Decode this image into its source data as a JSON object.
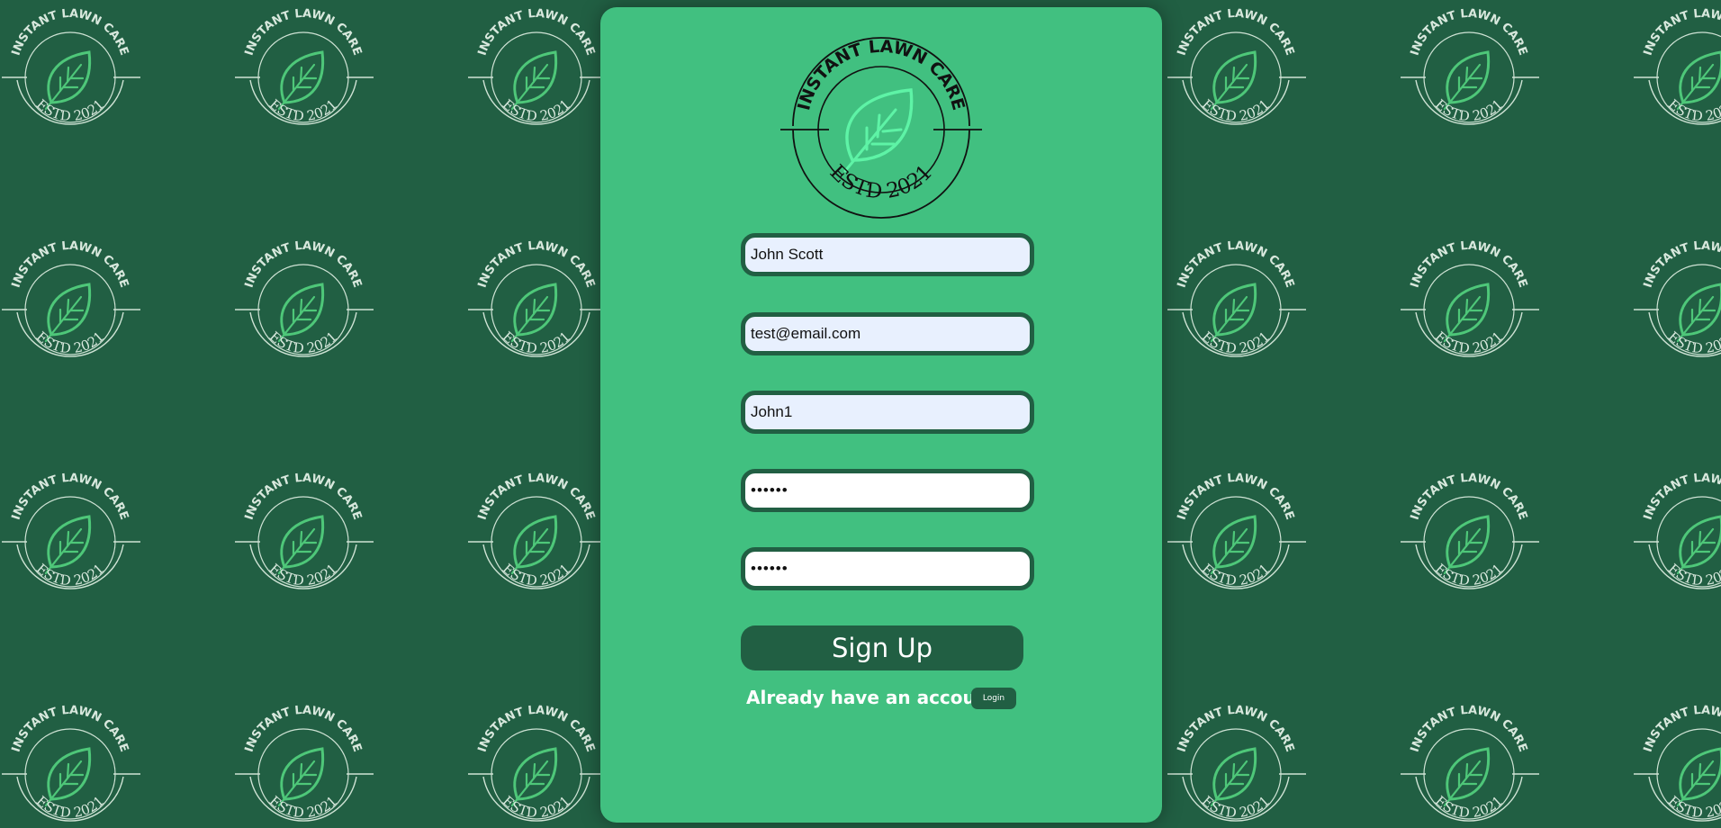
{
  "brand": {
    "arc_top": "INSTANT LAWN CARE",
    "arc_bottom": "ESTD 2021"
  },
  "colors": {
    "background": "#215f43",
    "card": "#41c080",
    "accent": "#215f43",
    "leaf_bright": "#5ef3a6",
    "leaf_pattern": "#4ec779",
    "autofill_bg": "#e8f0fe"
  },
  "form": {
    "full_name": {
      "value": "John Scott"
    },
    "email": {
      "value": "test@email.com"
    },
    "username": {
      "value": "John1"
    },
    "password": {
      "value": "••••••"
    },
    "confirm_password": {
      "value": "••••••"
    },
    "submit_label": "Sign Up"
  },
  "login_prompt": {
    "text": "Already have an account?",
    "button_label": "Login"
  },
  "icons": [
    "leaf-icon",
    "lawn-care-logo"
  ]
}
